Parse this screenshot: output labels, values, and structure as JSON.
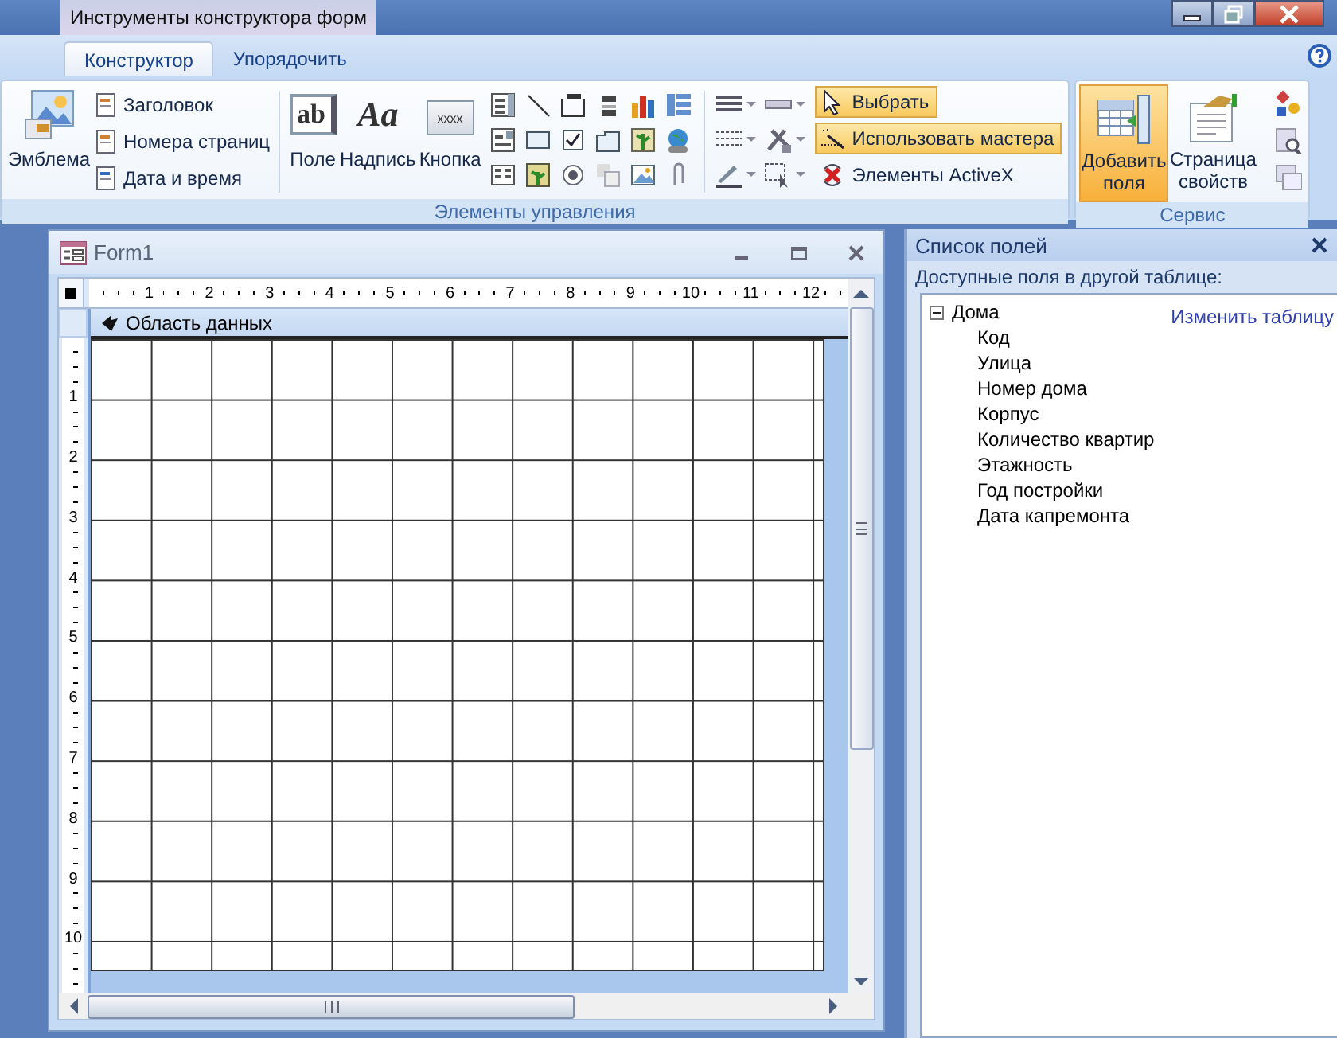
{
  "window": {
    "contextual_tab_group": "Инструменты конструктора форм"
  },
  "tabs": [
    {
      "label": "Конструктор",
      "selected": true
    },
    {
      "label": "Упорядочить",
      "selected": false
    }
  ],
  "ribbon": {
    "control_group": {
      "label": "Элементы управления",
      "emblem": "Эмблема",
      "header_items": [
        "Заголовок",
        "Номера страниц",
        "Дата и время"
      ],
      "large_controls": [
        {
          "label": "Поле",
          "glyph": "ab"
        },
        {
          "label": "Надпись",
          "glyph": "Aa"
        },
        {
          "label": "Кнопка",
          "glyph": "xxxx"
        }
      ],
      "mode_items": [
        {
          "label": "Выбрать",
          "selected": true
        },
        {
          "label": "Использовать мастера",
          "selected": true
        },
        {
          "label": "Элементы ActiveX",
          "selected": false
        }
      ]
    },
    "service_group": {
      "label": "Сервис",
      "buttons": [
        {
          "label": "Добавить поля",
          "selected": true
        },
        {
          "label": "Страница свойств",
          "selected": false
        }
      ]
    }
  },
  "form_window": {
    "title": "Form1",
    "ruler_marks": [
      "1",
      "2",
      "3",
      "4",
      "5",
      "6",
      "7",
      "8",
      "9",
      "10",
      "11",
      "12"
    ],
    "vertical_ruler_marks": [
      "1",
      "2",
      "3",
      "4",
      "5",
      "6",
      "7",
      "8",
      "9",
      "10"
    ],
    "section": "Область данных"
  },
  "field_list": {
    "title": "Список полей",
    "subtitle": "Доступные поля в другой таблице:",
    "link": "Изменить таблицу",
    "tree": [
      {
        "label": "Дома",
        "expanded": true,
        "children": [
          {
            "label": "Код"
          },
          {
            "label": "Улица"
          },
          {
            "label": "Номер дома"
          },
          {
            "label": "Корпус"
          },
          {
            "label": "Количество квартир"
          },
          {
            "label": "Этажность"
          },
          {
            "label": "Год постройки"
          },
          {
            "label": "Дата капремонта"
          }
        ]
      }
    ]
  }
}
